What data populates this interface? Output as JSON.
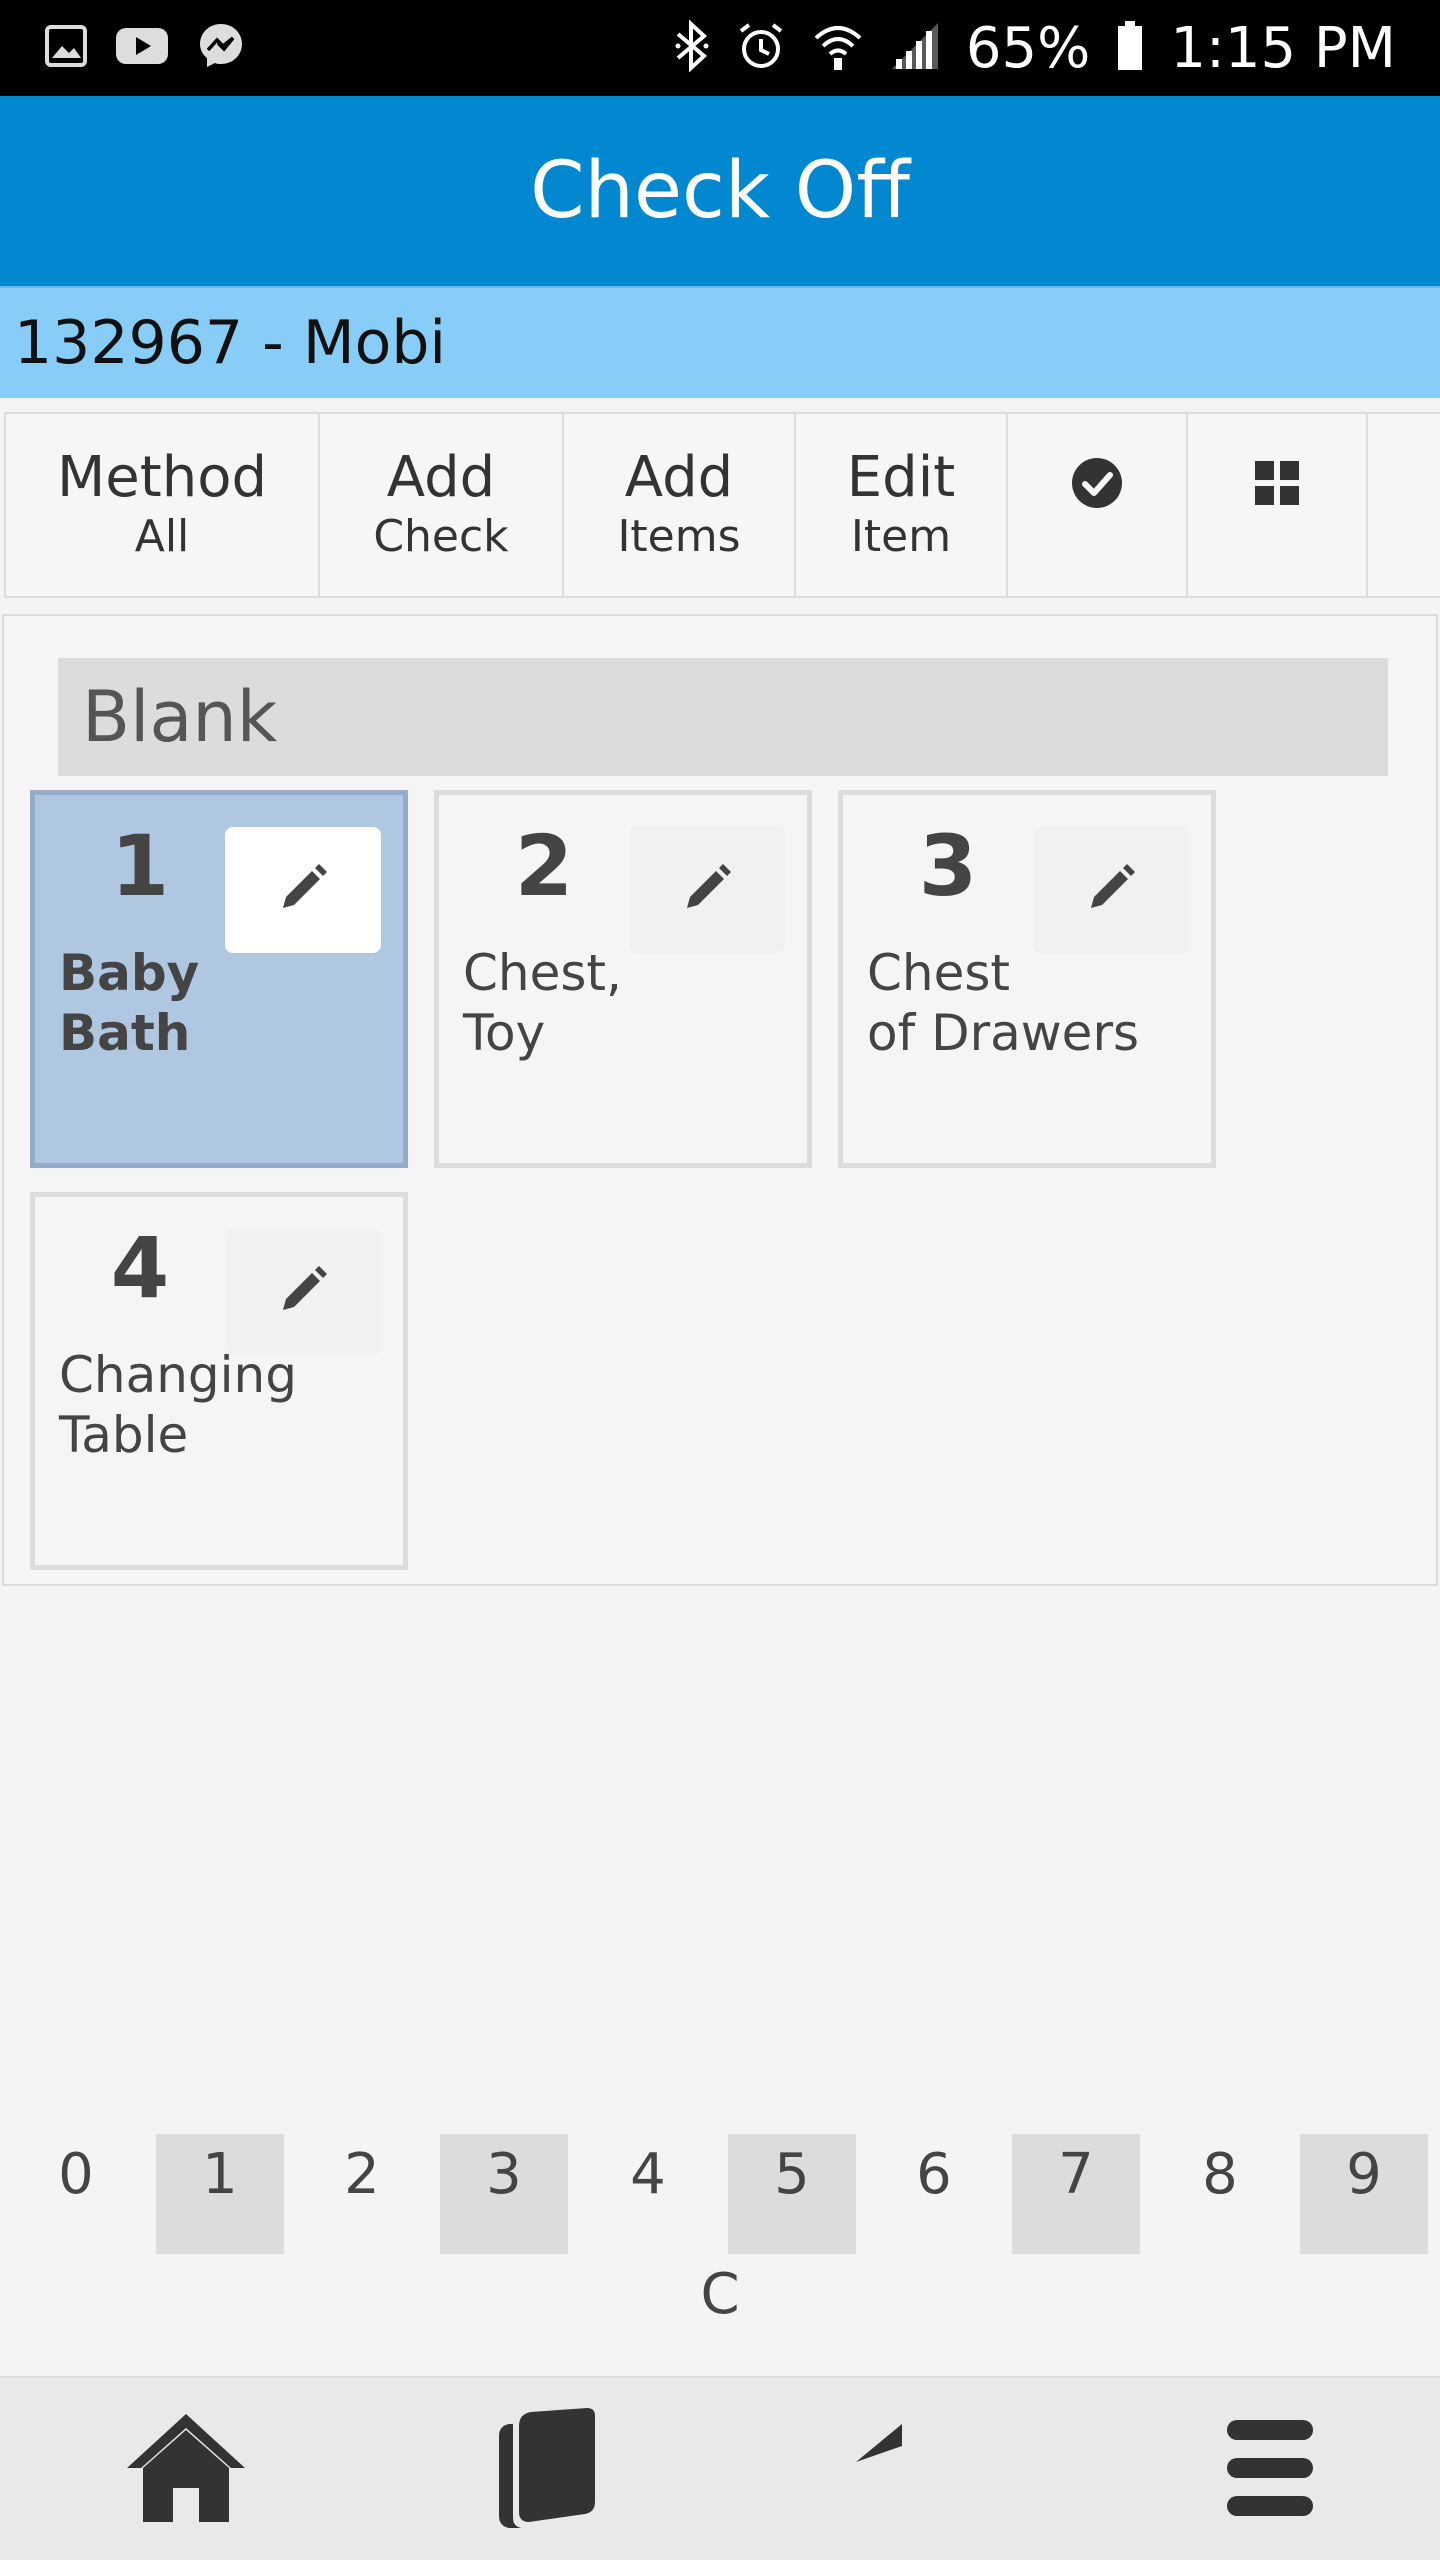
{
  "status_bar": {
    "battery": "65%",
    "time": "1:15 PM",
    "left_icons": [
      "gallery-icon",
      "youtube-icon",
      "messenger-icon"
    ],
    "right_icons": [
      "bluetooth-icon",
      "alarm-icon",
      "wifi-icon",
      "signal-icon",
      "battery-icon"
    ]
  },
  "header": {
    "title": "Check Off"
  },
  "sub_bar": {
    "text": "132967 - Mobi"
  },
  "toolbar": {
    "method": {
      "main": "Method",
      "sub": "All"
    },
    "add_check": {
      "main": "Add",
      "sub": "Check"
    },
    "add_items": {
      "main": "Add",
      "sub": "Items"
    },
    "edit_item": {
      "main": "Edit",
      "sub": "Item"
    },
    "icons": [
      "check-circle-icon",
      "grid-icon"
    ]
  },
  "group": {
    "title": "Blank",
    "items": [
      {
        "number": "1",
        "label": "Baby\nBath",
        "selected": true
      },
      {
        "number": "2",
        "label": "Chest,\nToy",
        "selected": false
      },
      {
        "number": "3",
        "label": "Chest\nof Drawers",
        "selected": false
      },
      {
        "number": "4",
        "label": "Changing\nTable",
        "selected": false
      }
    ]
  },
  "numpad": {
    "keys": [
      "0",
      "1",
      "2",
      "3",
      "4",
      "5",
      "6",
      "7",
      "8",
      "9"
    ],
    "clear": "C"
  },
  "bottom_nav": {
    "icons": [
      "home-icon",
      "book-icon",
      "back-icon",
      "menu-icon"
    ]
  },
  "colors": {
    "header": "#0288d1",
    "sub_bar": "#88ccf8",
    "selected_tile": "#b0c7e2",
    "shaded_key": "#dcdcdc"
  }
}
